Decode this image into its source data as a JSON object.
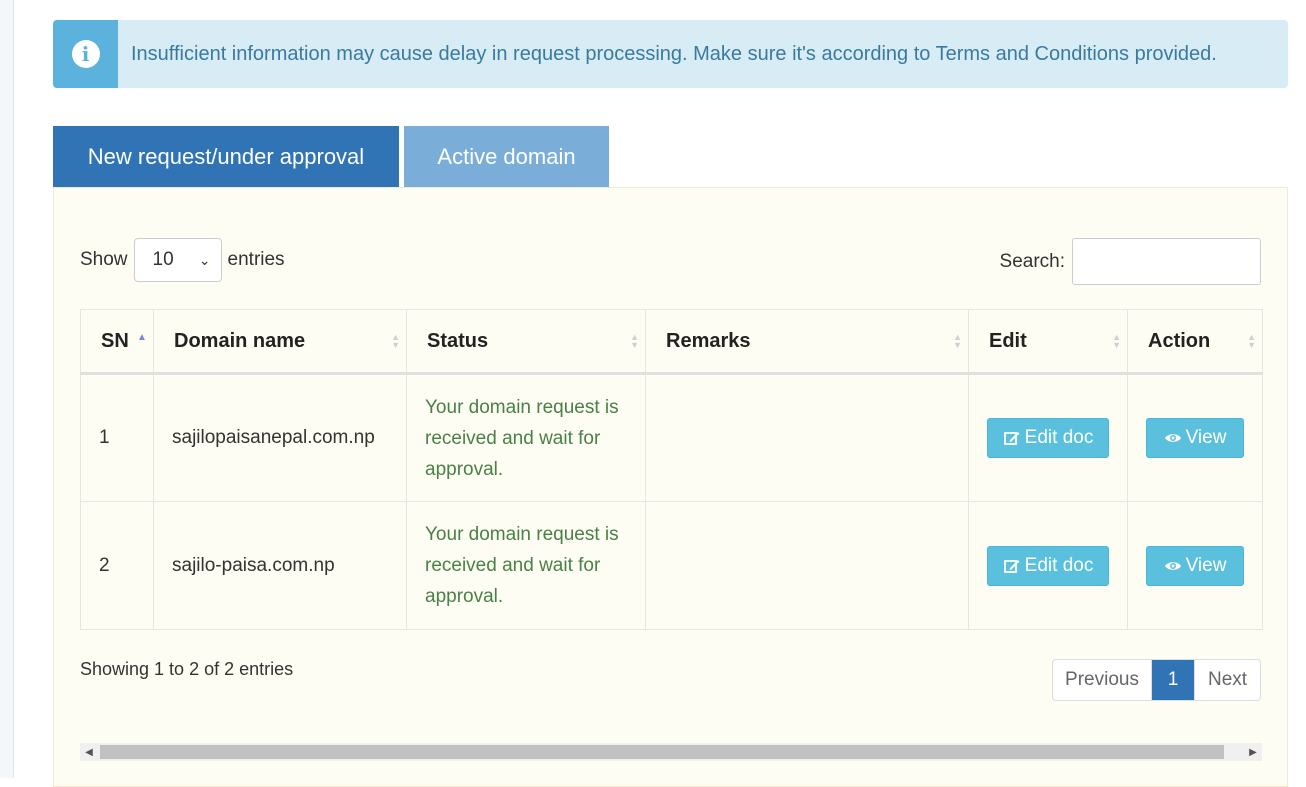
{
  "alert": {
    "icon": "info-circle-icon",
    "text": "Insufficient information may cause delay in request processing. Make sure it's according to Terms and Conditions provided."
  },
  "tabs": [
    {
      "label": "New request/under approval",
      "active": true
    },
    {
      "label": "Active domain",
      "active": false
    }
  ],
  "length": {
    "show_label": "Show",
    "value": "10",
    "entries_label": "entries"
  },
  "search": {
    "label": "Search:",
    "value": ""
  },
  "table": {
    "headers": [
      "SN",
      "Domain name",
      "Status",
      "Remarks",
      "Edit",
      "Action"
    ],
    "rows": [
      {
        "sn": "1",
        "domain": "sajilopaisanepal.com.np",
        "status": "Your domain request is received and wait for approval.",
        "remarks": "",
        "edit_label": "Edit doc",
        "action_label": "View"
      },
      {
        "sn": "2",
        "domain": "sajilo-paisa.com.np",
        "status": "Your domain request is received and wait for approval.",
        "remarks": "",
        "edit_label": "Edit doc",
        "action_label": "View"
      }
    ]
  },
  "info": "Showing 1 to 2 of 2 entries",
  "pagination": {
    "previous": "Previous",
    "current": "1",
    "next": "Next"
  },
  "colors": {
    "primary": "#3074b5",
    "tab_inactive": "#7aaed9",
    "info_button": "#5bc0de",
    "status_text": "#4a8046",
    "alert_bg": "#d7ecf5",
    "panel_bg": "#fdfdf4"
  }
}
